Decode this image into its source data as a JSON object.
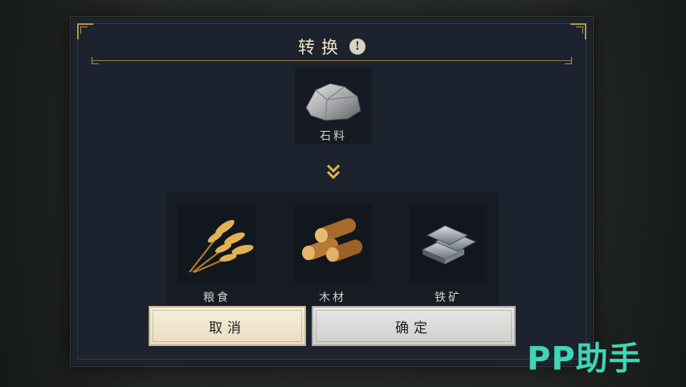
{
  "dialog": {
    "title": "转换",
    "source": {
      "label": "石料",
      "icon": "stone-icon"
    },
    "arrow_icon": "chevron-down-double-icon",
    "targets": [
      {
        "label": "粮食",
        "icon": "wheat-icon"
      },
      {
        "label": "木材",
        "icon": "wood-logs-icon"
      },
      {
        "label": "铁矿",
        "icon": "iron-ingots-icon"
      }
    ],
    "buttons": {
      "cancel": "取消",
      "confirm": "确定"
    }
  },
  "watermark": "PP助手",
  "colors": {
    "accent_gold": "#b8954a",
    "panel": "#1c222e",
    "watermark": "#3fd6b3"
  }
}
